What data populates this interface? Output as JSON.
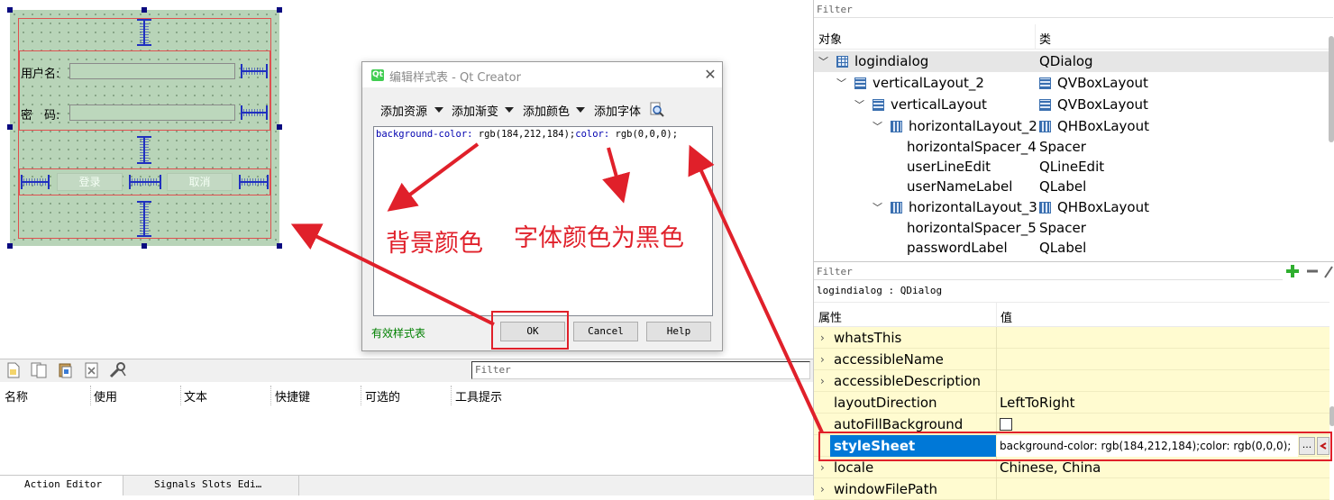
{
  "form_preview": {
    "username_label": "用户名:",
    "password_label": "密　码:",
    "login_button": "登录",
    "cancel_button": "取消"
  },
  "stylesheet_dialog": {
    "title": "编辑样式表 - Qt Creator",
    "toolbar": {
      "add_resource": "添加资源",
      "add_gradient": "添加渐变",
      "add_color": "添加颜色",
      "add_font": "添加字体"
    },
    "editor": {
      "prop1": "background-color:",
      "val1": " rgb(184,212,184);",
      "prop2": "color:",
      "val2": " rgb(0,0,0);"
    },
    "valid_label": "有效样式表",
    "ok": "OK",
    "cancel": "Cancel",
    "help": "Help"
  },
  "annotations": {
    "background_color": "背景颜色",
    "font_color": "字体颜色为黑色"
  },
  "action_editor": {
    "filter_placeholder": "Filter",
    "columns": [
      "名称",
      "使用",
      "文本",
      "快捷键",
      "可选的",
      "工具提示"
    ],
    "tabs": [
      "Action Editor",
      "Signals  Slots Edi…"
    ]
  },
  "object_inspector": {
    "filter_placeholder": "Filter",
    "headers": {
      "object": "对象",
      "class": "类"
    },
    "rows": [
      {
        "name": "logindialog",
        "class": "QDialog"
      },
      {
        "name": "verticalLayout_2",
        "class": "QVBoxLayout"
      },
      {
        "name": "verticalLayout",
        "class": "QVBoxLayout"
      },
      {
        "name": "horizontalLayout_2",
        "class": "QHBoxLayout"
      },
      {
        "name": "horizontalSpacer_4",
        "class": "Spacer"
      },
      {
        "name": "userLineEdit",
        "class": "QLineEdit"
      },
      {
        "name": "userNameLabel",
        "class": "QLabel"
      },
      {
        "name": "horizontalLayout_3",
        "class": "QHBoxLayout"
      },
      {
        "name": "horizontalSpacer_5",
        "class": "Spacer"
      },
      {
        "name": "passwordLabel",
        "class": "QLabel"
      }
    ]
  },
  "property_editor": {
    "filter_placeholder": "Filter",
    "object_label": "logindialog : QDialog",
    "headers": {
      "property": "属性",
      "value": "值"
    },
    "rows": [
      {
        "name": "whatsThis",
        "value": ""
      },
      {
        "name": "accessibleName",
        "value": ""
      },
      {
        "name": "accessibleDescription",
        "value": ""
      },
      {
        "name": "layoutDirection",
        "value": "LeftToRight"
      },
      {
        "name": "autoFillBackground",
        "value": ""
      },
      {
        "name": "styleSheet",
        "value": "background-color: rgb(184,212,184);color: rgb(0,0,0);"
      },
      {
        "name": "locale",
        "value": "Chinese, China"
      },
      {
        "name": "windowFilePath",
        "value": ""
      }
    ],
    "ellipsis_button": "..."
  },
  "colors": {
    "form_background": "#b8d4b8",
    "annotation_red": "#e0202a",
    "property_row_bg": "#fffbd0",
    "selection_blue": "#0078d7",
    "valid_green": "#008000"
  }
}
